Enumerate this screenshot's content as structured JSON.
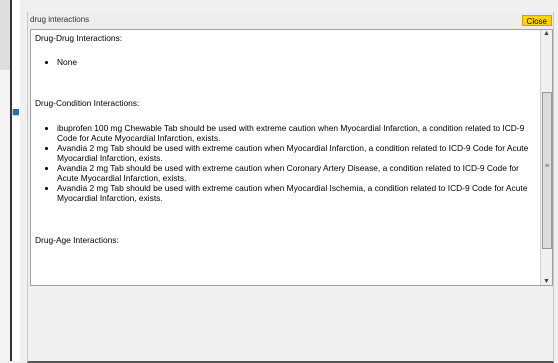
{
  "dialog": {
    "title": "drug interactions",
    "close_label": "Close"
  },
  "sections": {
    "drug_drug": {
      "heading": "Drug-Drug Interactions:",
      "items": [
        "None"
      ]
    },
    "drug_condition": {
      "heading": "Drug-Condition Interactions:",
      "items": [
        "ibuprofen 100 mg Chewable Tab should be used with extreme caution when Myocardial Infarction, a condition related to ICD-9 Code for Acute Myocardial Infarction, exists.",
        "Avandia 2 mg Tab should be used with extreme caution when Myocardial Infarction, a condition related to ICD-9 Code for Acute Myocardial Infarction, exists.",
        "Avandia 2 mg Tab should be used with extreme caution when Coronary Artery Disease, a condition related to ICD-9 Code for Acute Myocardial Infarction, exists.",
        "Avandia 2 mg Tab should be used with extreme caution when Myocardial Ischemia, a condition related to ICD-9 Code for Acute Myocardial Infarction, exists."
      ]
    },
    "drug_age": {
      "heading": "Drug-Age Interactions:"
    }
  },
  "icons": {
    "scroll_up": "scroll-up-arrow-icon",
    "scroll_down": "scroll-down-arrow-icon",
    "scroll_grip": "scroll-grip-icon"
  },
  "colors": {
    "close_button": "#ffd400",
    "titlebar": "#ededed",
    "content_bg": "#ffffff"
  }
}
